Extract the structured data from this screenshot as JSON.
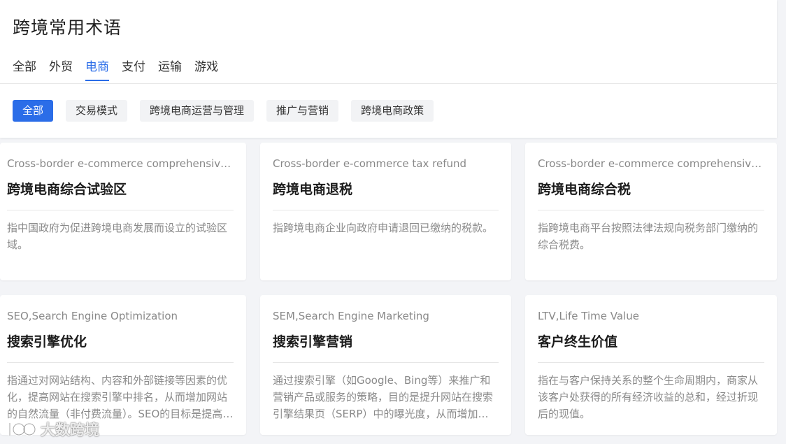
{
  "page": {
    "title": "跨境常用术语"
  },
  "tabs": [
    {
      "label": "全部",
      "active": false
    },
    {
      "label": "外贸",
      "active": false
    },
    {
      "label": "电商",
      "active": true
    },
    {
      "label": "支付",
      "active": false
    },
    {
      "label": "运输",
      "active": false
    },
    {
      "label": "游戏",
      "active": false
    }
  ],
  "chips": [
    {
      "label": "全部",
      "active": true
    },
    {
      "label": "交易模式",
      "active": false
    },
    {
      "label": "跨境电商运营与管理",
      "active": false
    },
    {
      "label": "推广与营销",
      "active": false
    },
    {
      "label": "跨境电商政策",
      "active": false
    }
  ],
  "cards": [
    {
      "en": "Cross-border e-commerce comprehensive test zone",
      "cn": "跨境电商综合试验区",
      "desc": "指中国政府为促进跨境电商发展而设立的试验区域。"
    },
    {
      "en": "Cross-border e-commerce tax refund",
      "cn": "跨境电商退税",
      "desc": "指跨境电商企业向政府申请退回已缴纳的税款。"
    },
    {
      "en": "Cross-border e-commerce comprehensive tax",
      "cn": "跨境电商综合税",
      "desc": "指跨境电商平台按照法律法规向税务部门缴纳的综合税费。"
    },
    {
      "en": "SEO,Search Engine Optimization",
      "cn": "搜索引擎优化",
      "desc": "指通过对网站结构、内容和外部链接等因素的优化，提高网站在搜索引擎中排名，从而增加网站的自然流量（非付费流量）。SEO的目标是提高网站的可见度。"
    },
    {
      "en": "SEM,Search Engine Marketing",
      "cn": "搜索引擎营销",
      "desc": "通过搜索引擎（如Google、Bing等）来推广和营销产品或服务的策略，目的是提升网站在搜索引擎结果页（SERP）中的曝光度，从而增加流量。"
    },
    {
      "en": "LTV,Life Time Value",
      "cn": "客户终生价值",
      "desc": "指在与客户保持关系的整个生命周期内，商家从该客户处获得的所有经济收益的总和，经过折现后的现值。"
    }
  ],
  "watermark": {
    "text": "大数跨境"
  },
  "colors": {
    "accent": "#2b6de8",
    "background": "#f3f4f7"
  }
}
